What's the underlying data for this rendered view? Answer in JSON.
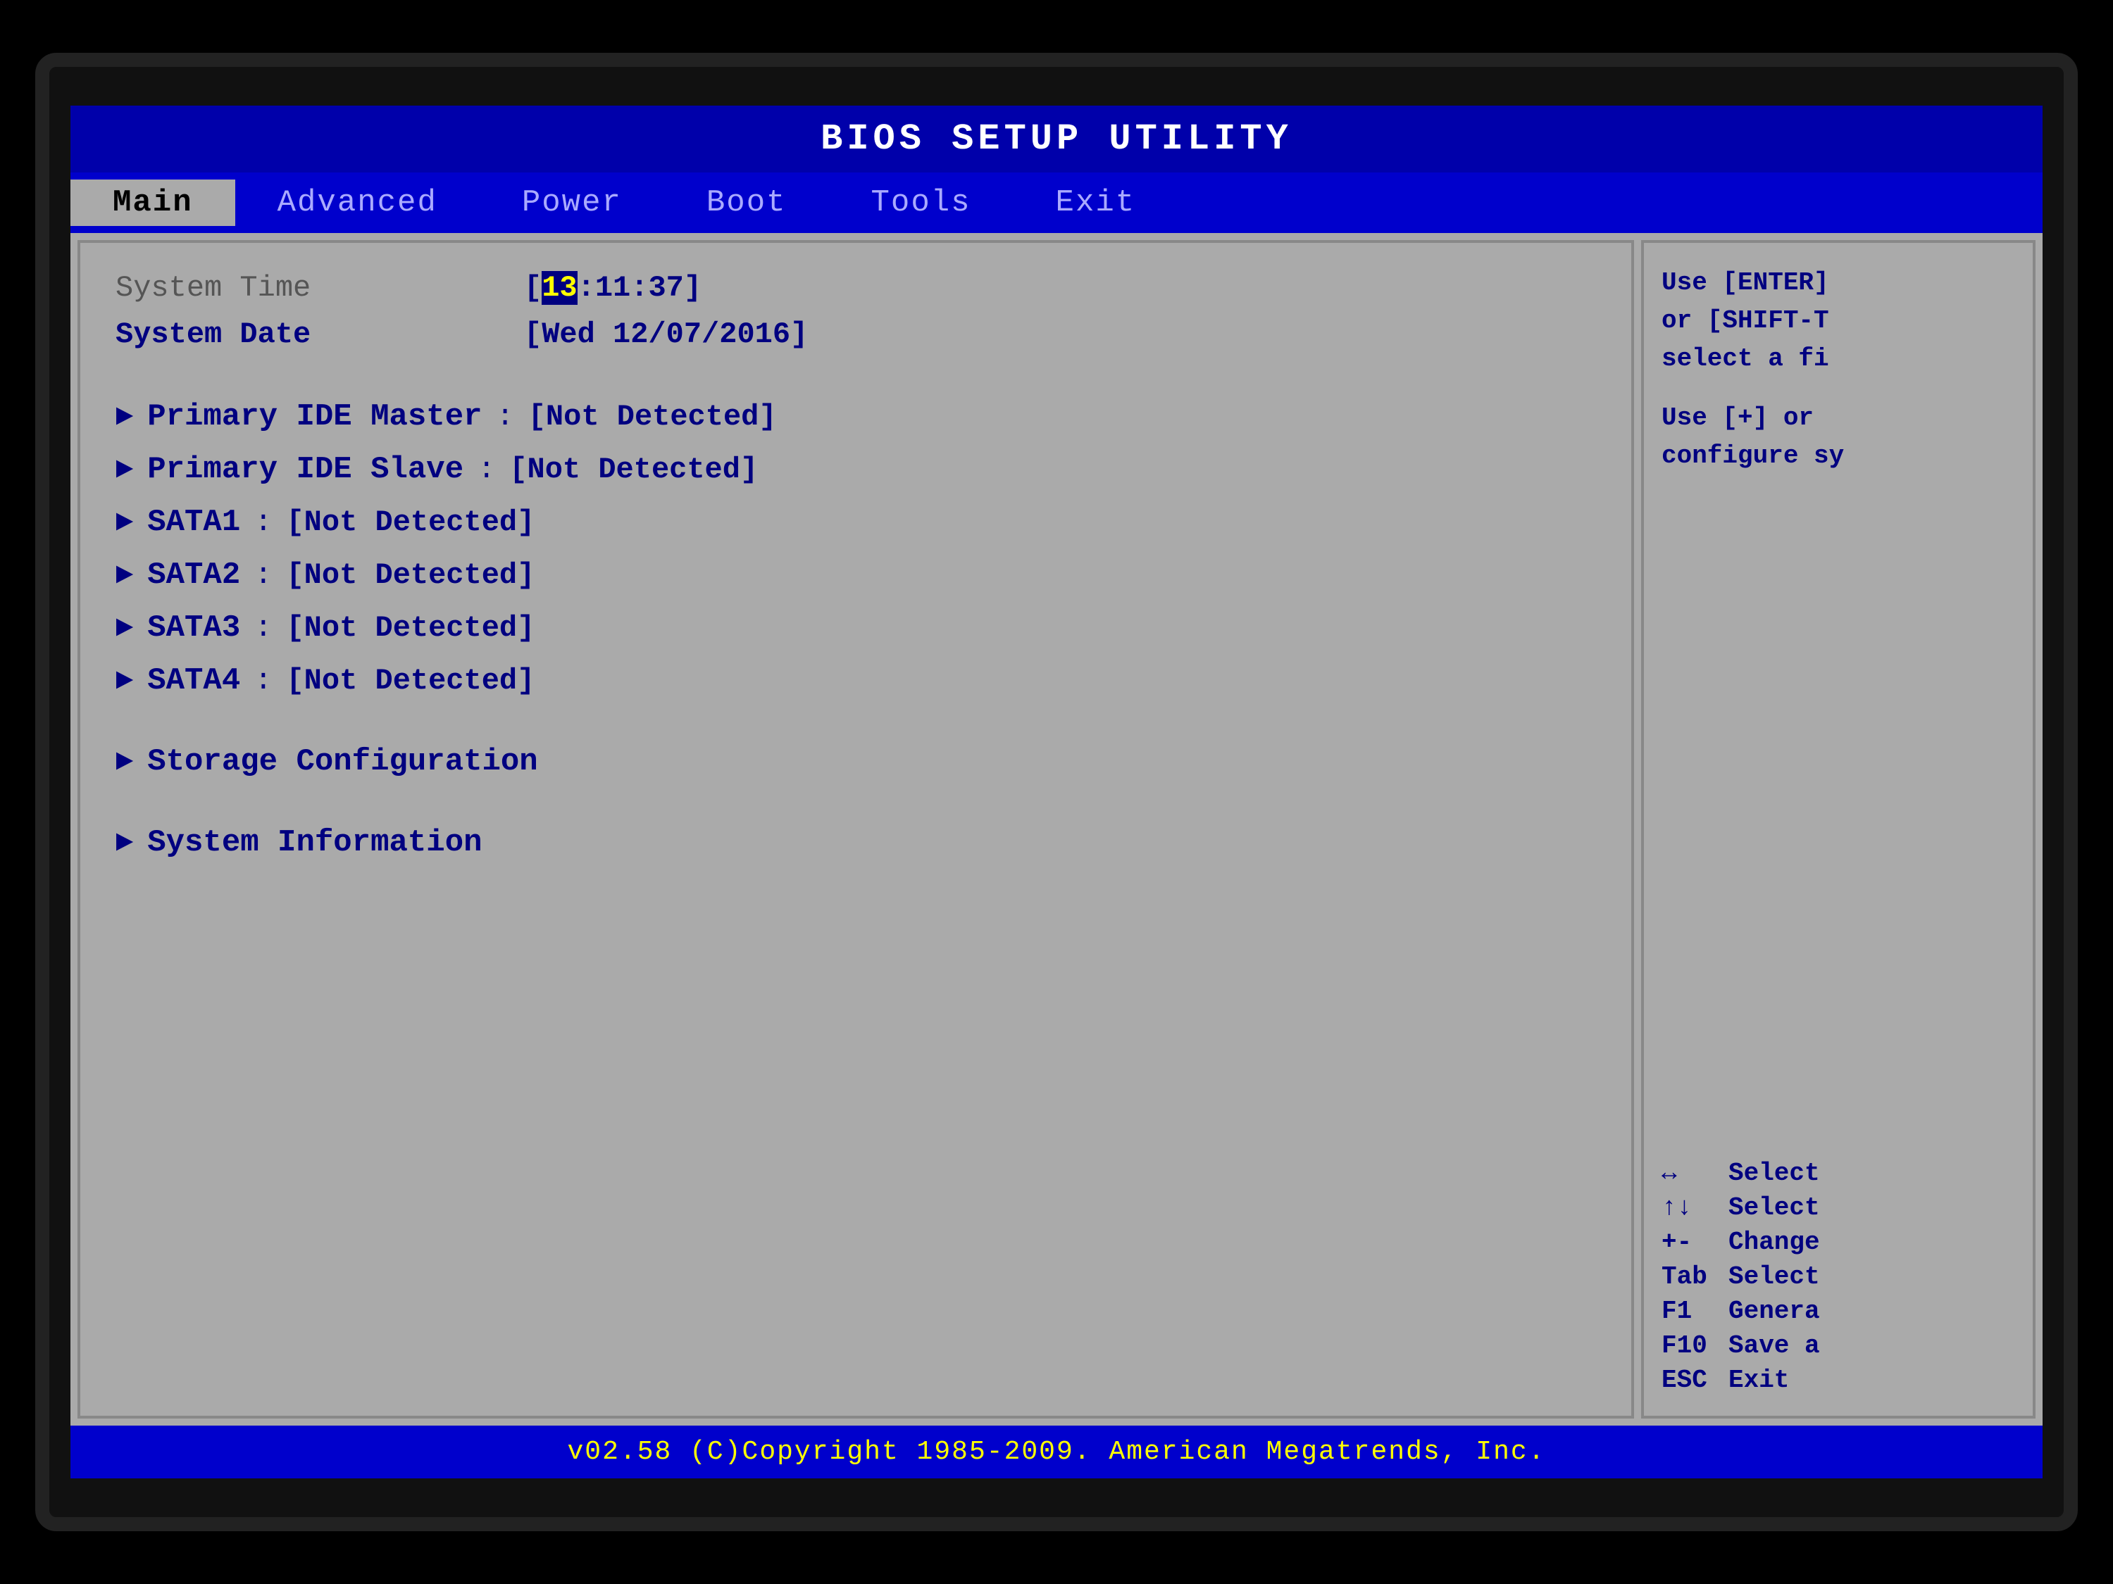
{
  "title": "BIOS SETUP UTILITY",
  "menu": {
    "items": [
      {
        "label": "Main",
        "active": true
      },
      {
        "label": "Advanced",
        "active": false
      },
      {
        "label": "Power",
        "active": false
      },
      {
        "label": "Boot",
        "active": false
      },
      {
        "label": "Tools",
        "active": false
      },
      {
        "label": "Exit",
        "active": false
      }
    ]
  },
  "main": {
    "system_time": {
      "label": "System Time",
      "value": "[13:11:37]",
      "value_selected": "13",
      "value_rest": ":11:37]"
    },
    "system_date": {
      "label": "System Date",
      "value": "[Wed 12/07/2016]"
    },
    "ide_master": {
      "label": "Primary IDE Master",
      "value": "[Not Detected]"
    },
    "ide_slave": {
      "label": "Primary IDE Slave",
      "value": "[Not Detected]"
    },
    "sata1": {
      "label": "SATA1",
      "value": "[Not Detected]"
    },
    "sata2": {
      "label": "SATA2",
      "value": "[Not Detected]"
    },
    "sata3": {
      "label": "SATA3",
      "value": "[Not Detected]"
    },
    "sata4": {
      "label": "SATA4",
      "value": "[Not Detected]"
    },
    "storage_config": {
      "label": "Storage Configuration"
    },
    "system_info": {
      "label": "System Information"
    }
  },
  "help": {
    "line1": "Use [ENTER]",
    "line2": "or [SHIFT-T",
    "line3": "select a fi",
    "line4": "",
    "line5": "Use [+] or",
    "line6": "configure sy"
  },
  "keys": [
    {
      "symbol": "↔",
      "desc": "Select"
    },
    {
      "symbol": "↑↓",
      "desc": "Select"
    },
    {
      "symbol": "+-",
      "desc": "Change"
    },
    {
      "symbol": "Tab",
      "desc": "Select"
    },
    {
      "symbol": "F1",
      "desc": "Genera"
    },
    {
      "symbol": "F10",
      "desc": "Save a"
    },
    {
      "symbol": "ESC",
      "desc": "Exit"
    }
  ],
  "footer": "v02.58  (C)Copyright 1985-2009. American Megatrends, Inc."
}
